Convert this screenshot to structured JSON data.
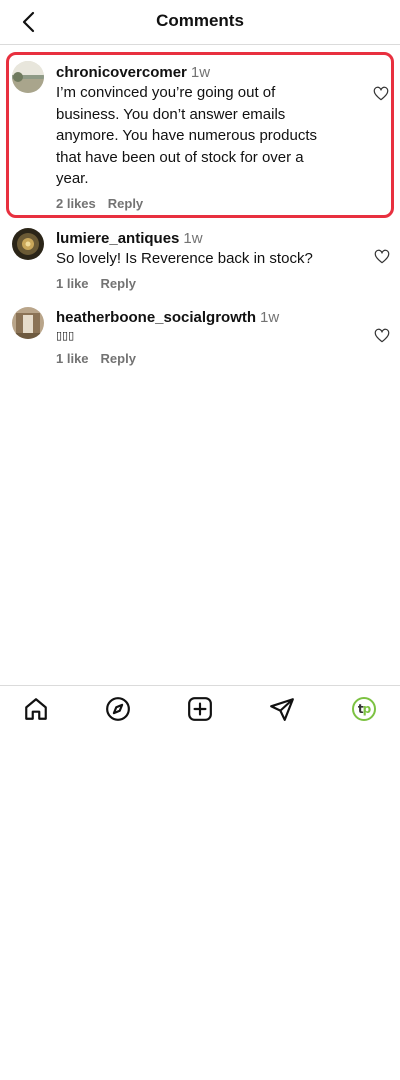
{
  "header": {
    "title": "Comments"
  },
  "comments": [
    {
      "username": "chronicovercomer",
      "time": "1w",
      "lines": [
        "I’m convinced you’re going out of",
        "business. You don’t answer emails",
        "anymore. You have numerous products",
        "that have been out of stock for over a",
        "year."
      ],
      "likes": "2 likes",
      "reply": "Reply",
      "avatar_icon": "landscape-photo-avatar"
    },
    {
      "username": "lumiere_antiques",
      "time": "1w",
      "lines": [
        "So lovely! Is Reverence back in stock?"
      ],
      "likes": "1 like",
      "reply": "Reply",
      "avatar_icon": "chandelier-photo-avatar"
    },
    {
      "username": "heatherboone_socialgrowth",
      "time": "1w",
      "lines": [
        "▯▯▯"
      ],
      "likes": "1 like",
      "reply": "Reply",
      "avatar_icon": "interior-photo-avatar"
    }
  ],
  "tabbar": {
    "items": [
      "home-icon",
      "explore-compass-icon",
      "create-plus-icon",
      "direct-message-icon",
      "profile-avatar-icon"
    ],
    "profile_logo": {
      "t": "t",
      "p": "p"
    }
  },
  "colors": {
    "highlight": "#e8303f",
    "secondary_text": "#737373",
    "brand_green": "#7cc242"
  }
}
